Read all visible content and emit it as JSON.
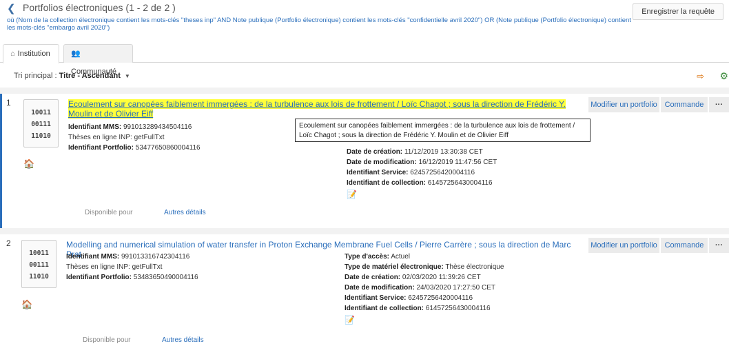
{
  "header": {
    "back_glyph": "❮",
    "title": "Portfolios électroniques (1 - 2 de 2 )",
    "query": "où (Nom de la collection électronique contient les mots-clés \"theses inp\" AND Note publique (Portfolio électronique) contient les mots-clés \"confidentielle avril 2020\") OR (Note publique (Portfolio électronique) contient les mots-clés \"embargo avril 2020\")",
    "save_label": "Enregistrer la requête"
  },
  "tabs": [
    {
      "label": "Institution",
      "icon": "home-icon",
      "active": true
    },
    {
      "label": "Communauté",
      "icon": "users-icon",
      "active": false
    }
  ],
  "sort": {
    "prefix": "Tri principal :",
    "value": "Titre - Ascendant"
  },
  "records": [
    {
      "index": "1",
      "thumb_digits": [
        "10011",
        "00111",
        "11010"
      ],
      "title": "Ecoulement sur canopées faiblement immergées : de la turbulence aux lois de frottement / Loïc Chagot ; sous la direction de Frédéric Y. Moulin et de Olivier Eiff",
      "left_fields": [
        {
          "label": "Identifiant MMS:",
          "value": "991013289434504116"
        },
        {
          "label": "",
          "value": "Thèses en ligne INP: getFullTxt"
        },
        {
          "label": "Identifiant Portfolio:",
          "value": "53477650860004116"
        }
      ],
      "right_fields": [
        {
          "label": "Date de création:",
          "value": "11/12/2019 13:30:38 CET"
        },
        {
          "label": "Date de modification:",
          "value": "16/12/2019 11:47:56 CET"
        },
        {
          "label": "Identifiant Service:",
          "value": "62457256420004116"
        },
        {
          "label": "Identifiant de collection:",
          "value": "61457256430004116"
        }
      ],
      "actions": {
        "modify": "Modifier un portfolio",
        "order": "Commande",
        "more": "···"
      },
      "links": {
        "available": "Disponible pour",
        "details": "Autres détails"
      }
    },
    {
      "index": "2",
      "thumb_digits": [
        "10011",
        "00111",
        "11010"
      ],
      "title": "Modelling and numerical simulation of water transfer in Proton Exchange Membrane Fuel Cells / Pierre Carrère ; sous la direction de Marc Prat",
      "left_fields": [
        {
          "label": "Identifiant MMS:",
          "value": "991013316742304116"
        },
        {
          "label": "",
          "value": "Thèses en ligne INP: getFullTxt"
        },
        {
          "label": "Identifiant Portfolio:",
          "value": "53483650490004116"
        }
      ],
      "right_fields": [
        {
          "label": "Type d'accès:",
          "value": "Actuel"
        },
        {
          "label": "Type de matériel électronique:",
          "value": "Thèse électronique"
        },
        {
          "label": "Date de création:",
          "value": "02/03/2020 11:39:26 CET"
        },
        {
          "label": "Date de modification:",
          "value": "24/03/2020 17:27:50 CET"
        },
        {
          "label": "Identifiant Service:",
          "value": "62457256420004116"
        },
        {
          "label": "Identifiant de collection:",
          "value": "61457256430004116"
        }
      ],
      "actions": {
        "modify": "Modifier un portfolio",
        "order": "Commande",
        "more": "···"
      },
      "links": {
        "available": "Disponible pour",
        "details": "Autres détails"
      }
    }
  ],
  "tooltip": "Ecoulement sur canopées faiblement immergées : de la turbulence aux lois de frottement / Loïc Chagot ; sous la direction de Frédéric Y. Moulin et de Olivier Eiff",
  "colors": {
    "link": "#2a6ebb",
    "highlight": "#ffff3a",
    "accent_border": "#2a6ebb",
    "export": "#d96b00",
    "settings": "#3a8a3a"
  }
}
